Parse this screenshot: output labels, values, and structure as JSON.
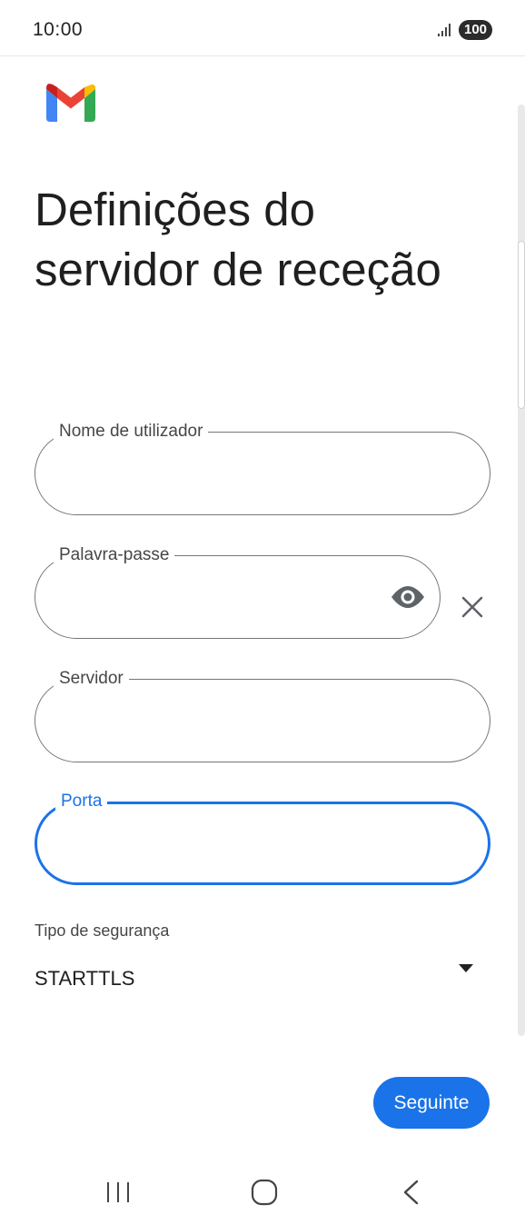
{
  "status_bar": {
    "time": "10:00",
    "battery": "100"
  },
  "title": "Definições do servidor de receção",
  "fields": {
    "username": {
      "label": "Nome de utilizador",
      "value": ""
    },
    "password": {
      "label": "Palavra-passe",
      "value": ""
    },
    "server": {
      "label": "Servidor",
      "value": ""
    },
    "port": {
      "label": "Porta",
      "value": ""
    }
  },
  "security": {
    "label": "Tipo de segurança",
    "value": "STARTTLS"
  },
  "next_button": {
    "label": "Seguinte"
  },
  "icons": {
    "logo": "gmail-logo",
    "password_toggle": "eye-icon",
    "clear": "close-icon",
    "dropdown": "dropdown-arrow-icon",
    "nav": [
      "recent-apps-icon",
      "home-icon",
      "back-icon"
    ]
  },
  "colors": {
    "accent": "#1a73e8",
    "outline": "#747775"
  }
}
